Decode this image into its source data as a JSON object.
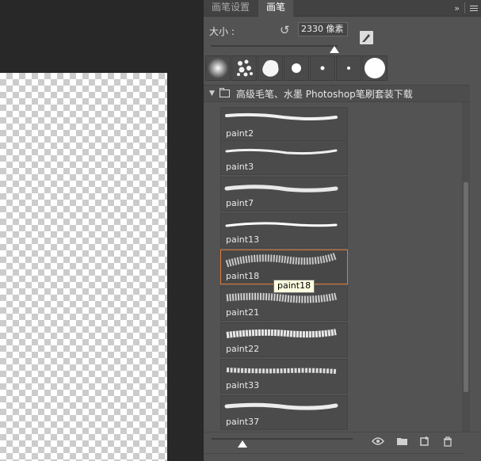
{
  "tabs": [
    {
      "label": "画笔设置",
      "active": false
    },
    {
      "label": "画笔",
      "active": true
    }
  ],
  "panel_controls": {
    "collapse": "»",
    "menu": "≡"
  },
  "size": {
    "label": "大小 :",
    "value": "2330 像素",
    "slider_fraction": 0.98
  },
  "group": {
    "title": "高级毛笔、水墨 Photoshop笔刷套装下载"
  },
  "brushes": [
    {
      "label": "paint2"
    },
    {
      "label": "paint3"
    },
    {
      "label": "paint7"
    },
    {
      "label": "paint13"
    },
    {
      "label": "paint18",
      "selected": true
    },
    {
      "label": "paint21"
    },
    {
      "label": "paint22"
    },
    {
      "label": "paint33"
    },
    {
      "label": "paint37"
    }
  ],
  "tooltip": {
    "text": "paint18"
  },
  "preview_slider_fraction": 0.2,
  "colors": {
    "accent_selected": "#e07a3a",
    "panel_bg": "#535353",
    "canvas_bg": "#282828",
    "tooltip_bg": "#ffffe1"
  },
  "icons": [
    "reset-icon",
    "brush-settings-icon",
    "folder-icon",
    "eye-icon",
    "new-group-icon",
    "new-brush-icon",
    "trash-icon"
  ]
}
